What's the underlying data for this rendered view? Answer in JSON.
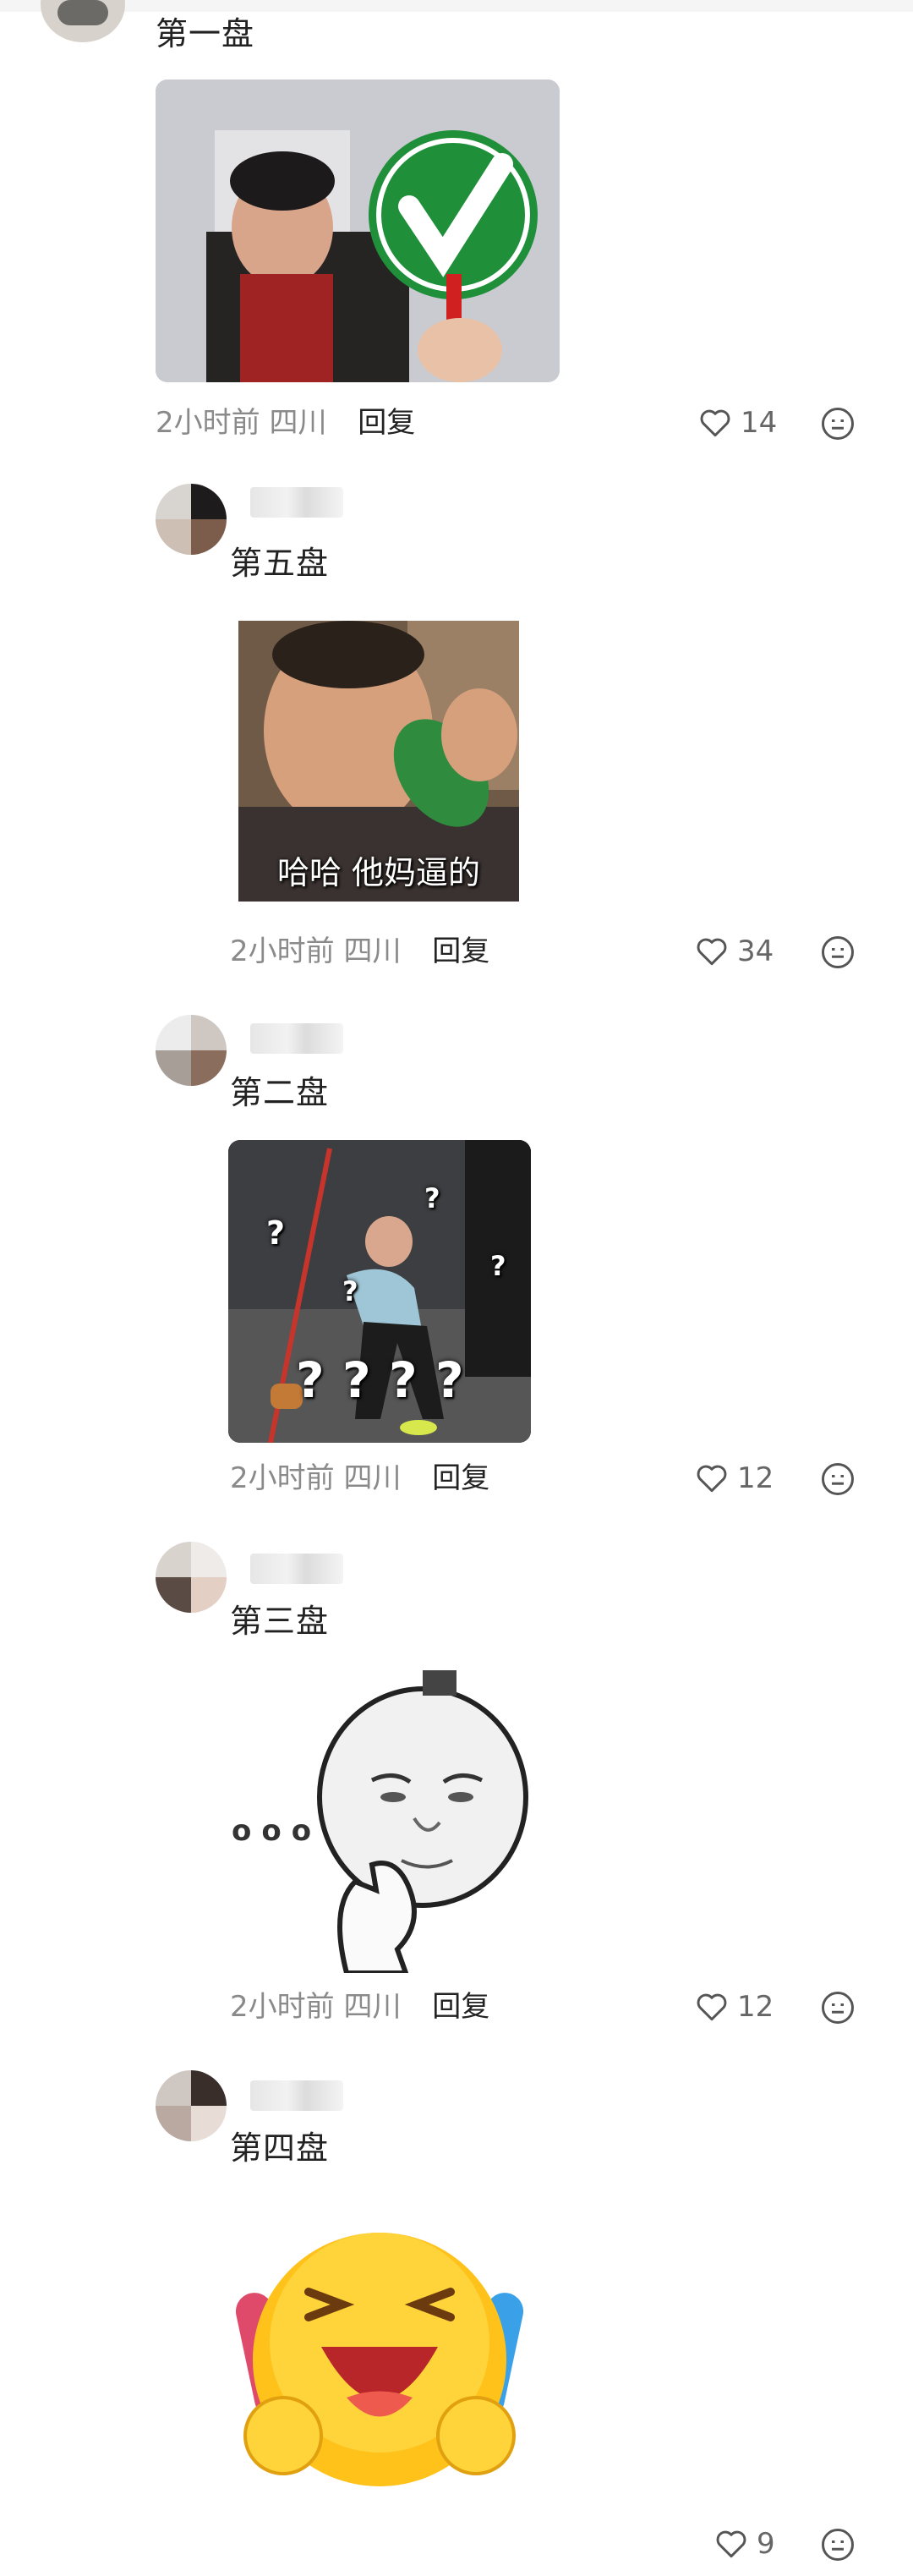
{
  "comments": [
    {
      "text": "第一盘",
      "time": "2小时前",
      "location": "四川",
      "reply": "回复",
      "likes": "14"
    },
    {
      "text": "第五盘",
      "time": "2小时前",
      "location": "四川",
      "reply": "回复",
      "likes": "34",
      "caption": "哈哈 他妈逼的"
    },
    {
      "text": "第二盘",
      "time": "2小时前",
      "location": "四川",
      "reply": "回复",
      "likes": "12",
      "qmarks": [
        "?",
        "?",
        "?",
        "?",
        "?",
        "?",
        "?",
        "?"
      ]
    },
    {
      "text": "第三盘",
      "time": "2小时前",
      "location": "四川",
      "reply": "回复",
      "likes": "12",
      "dots": "ooo"
    },
    {
      "text": "第四盘",
      "likes": "9"
    }
  ],
  "icons": {
    "like": "heart-outline-icon",
    "more": "face-menu-icon"
  },
  "colors": {
    "meta": "#8a8a8a",
    "check_green": "#1f8f3a",
    "background": "#ffffff"
  }
}
